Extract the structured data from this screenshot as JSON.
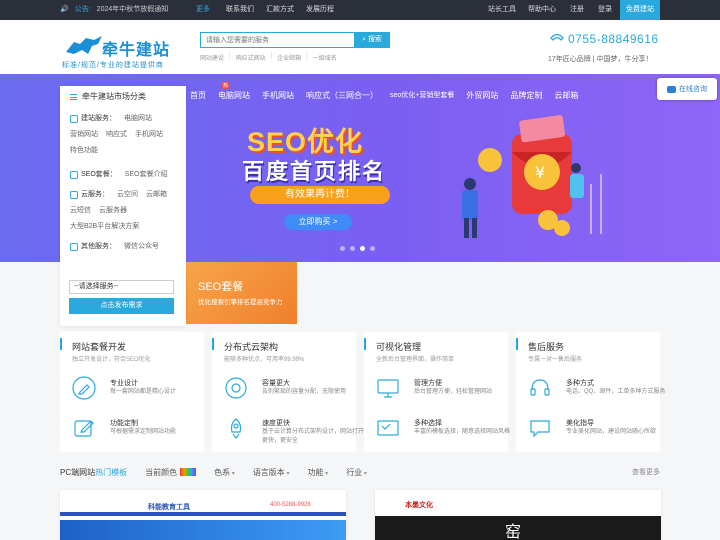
{
  "topbar": {
    "notice_label": "公告:",
    "notice_text": "2024年中秋节放假通知",
    "links_left": [
      "更多",
      "联系我们",
      "汇款方式",
      "发展历程"
    ],
    "links_right": [
      "站长工具",
      "帮助中心",
      "注册",
      "登录"
    ],
    "free_build": "免费建站"
  },
  "header": {
    "brand": "牵牛建站",
    "slogan": "标准/规范/专业的建站提供商",
    "search_placeholder": "请输入您需要的服务",
    "search_button": "搜索",
    "hotwords": [
      "网站建设",
      "响应式网站",
      "企业邮箱",
      "一级域名"
    ],
    "phone": "0755-88849616",
    "tagline": "17年匠心品牌 | 中国梦，牛分享！"
  },
  "nav": [
    "首页",
    "电脑网站",
    "手机网站",
    "响应式（三网合一）",
    "seo优化+营销型套餐",
    "外贸网站",
    "品牌定制",
    "云邮箱"
  ],
  "banner": {
    "title": "SEO优化",
    "subtitle": "百度首页排名",
    "pill": "有效果再计费！",
    "buy": "立即购买 >",
    "online": "在线咨询"
  },
  "catmenu": {
    "head": "牵牛建站市场分类",
    "groups": [
      {
        "key": "建站服务：",
        "items": [
          "电脑网站",
          "营销网站",
          "响应式",
          "手机网站",
          "特色功能"
        ]
      },
      {
        "key": "SEO套餐：",
        "items": [
          "SEO套餐介绍"
        ]
      },
      {
        "key": "云服务：",
        "items": [
          "云空间",
          "云邮箱",
          "云短信",
          "云服务器",
          "大型B2B平台解决方案"
        ]
      },
      {
        "key": "其他服务：",
        "items": [
          "微信公众号"
        ]
      }
    ],
    "select": "--请选择服务--",
    "submit": "点击发布需求"
  },
  "seo_card": {
    "title": "SEO套餐",
    "desc": "优化搜索引擎排名提高竞争力"
  },
  "features": [
    {
      "title": "网站套餐开发",
      "sub": "独立开发设计，符合SEO优化",
      "items": [
        {
          "t": "专业设计",
          "d": "每一套网站都是精心设计"
        },
        {
          "t": "功能定制",
          "d": "可根据需求定制网站功能"
        }
      ]
    },
    {
      "title": "分布式云架构",
      "sub": "能够多种优点，可用率99.99%",
      "items": [
        {
          "t": "容量更大",
          "d": "告别繁琐的容量分配，无限使用"
        },
        {
          "t": "速度更快",
          "d": "基于云计算分布式架构设计，网站打开更快，更安全"
        }
      ]
    },
    {
      "title": "可视化管理",
      "sub": "全新后台管理界面，操作简单",
      "items": [
        {
          "t": "管理方便",
          "d": "后台管理方便，轻松管理网站"
        },
        {
          "t": "多种选择",
          "d": "丰富的模板选择，随意选择网站风格"
        }
      ]
    },
    {
      "title": "售后服务",
      "sub": "专属一对一售后服务",
      "items": [
        {
          "t": "多种方式",
          "d": "电话、QQ、邮件，工单多种方式服务"
        },
        {
          "t": "美化指导",
          "d": "专业美化网站，建设网站随心所欲"
        }
      ]
    }
  ],
  "filter": {
    "pc_prefix": "PC端网站",
    "pc_hot": "热门模板",
    "color_label": "当前颜色",
    "dropdowns": [
      "色系",
      "语言版本",
      "功能",
      "行业"
    ],
    "more": "查看更多"
  },
  "templates": [
    {
      "logo": "科能教育工具",
      "phone": "400-5288-9928"
    },
    {
      "logo": "本墨文化",
      "big": "窑"
    }
  ],
  "colors": {
    "accent": "#2aa9dd",
    "topbar": "#2b2f3a",
    "banner": "#7b5ff2",
    "seo": "#f07f2c"
  }
}
